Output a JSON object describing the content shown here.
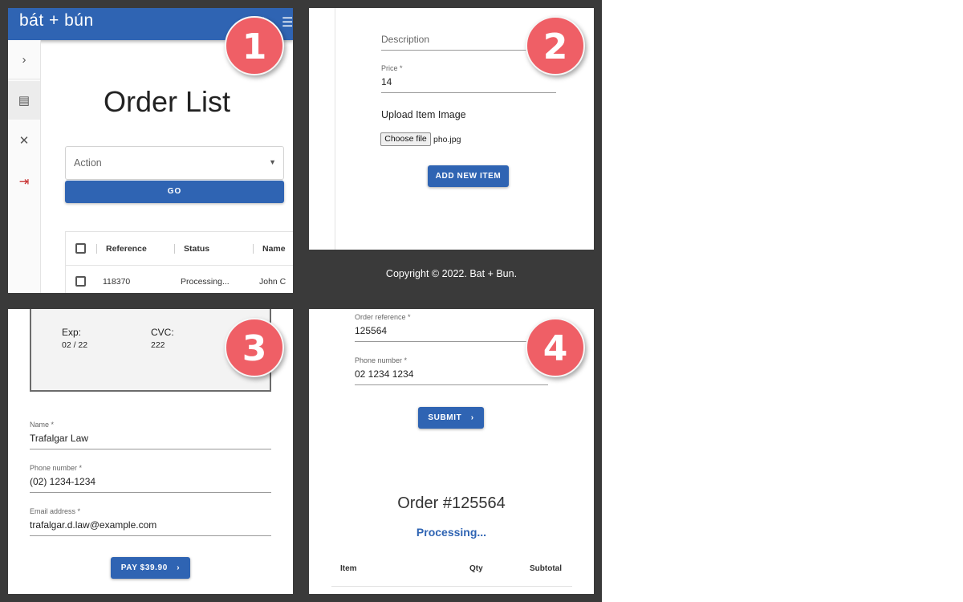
{
  "panel1": {
    "logo": "bát + bún",
    "page_title": "Order List",
    "action_select": "Action",
    "go_button": "GO",
    "table_headers": [
      "Reference",
      "Status",
      "Name"
    ],
    "table_rows": [
      {
        "reference": "118370",
        "status": "Processing...",
        "name": "John C"
      }
    ]
  },
  "panel2": {
    "description_placeholder": "Description",
    "price_label": "Price *",
    "price_value": "14",
    "upload_title": "Upload Item Image",
    "choose_file": "Choose file",
    "file_name": "pho.jpg",
    "add_button": "ADD NEW ITEM"
  },
  "footer": {
    "copyright": "Copyright © 2022. Bat + Bun."
  },
  "panel3": {
    "exp_label": "Exp:",
    "exp_value": "02 / 22",
    "cvc_label": "CVC:",
    "cvc_value": "222",
    "name_label": "Name *",
    "name_value": "Trafalgar Law",
    "phone_label": "Phone number *",
    "phone_value": "(02) 1234-1234",
    "email_label": "Email address *",
    "email_value": "trafalgar.d.law@example.com",
    "pay_button": "PAY $39.90"
  },
  "panel4": {
    "order_ref_label": "Order reference *",
    "order_ref_value": "125564",
    "phone_label": "Phone number *",
    "phone_value": "02 1234 1234",
    "submit_button": "SUBMIT",
    "order_heading": "Order #125564",
    "status": "Processing...",
    "items_headers": [
      "Item",
      "Qty",
      "Subtotal"
    ]
  },
  "badges": [
    "1",
    "2",
    "3",
    "4"
  ],
  "colors": {
    "primary": "#2f64b3",
    "badge": "#ef5f66",
    "background": "#3a3a3a",
    "logout": "#c62828"
  },
  "icons": {
    "appbar": [
      "list-icon",
      "menu-icon"
    ],
    "sidebar": [
      "chevron-right-icon",
      "orders-icon",
      "utensils-icon",
      "logout-icon"
    ],
    "buttons": [
      "chevron-right-icon"
    ],
    "select": [
      "dropdown-arrow-icon"
    ]
  }
}
